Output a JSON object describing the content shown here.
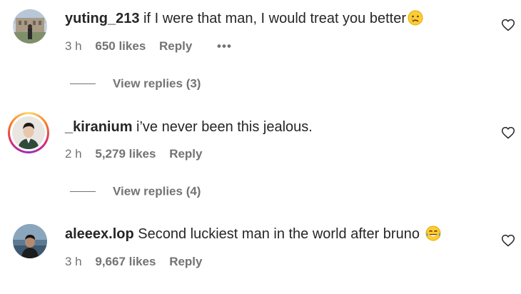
{
  "comments": [
    {
      "username": "yuting_213",
      "text": "if I were that man, I would treat you better",
      "emoji": "sad-face-emoji",
      "time": "3 h",
      "likes": "650 likes",
      "reply": "Reply",
      "more": "•••",
      "view_replies": "View replies (3)",
      "story_ring": false
    },
    {
      "username": "_kiranium",
      "text": "i’ve never been this jealous.",
      "time": "2 h",
      "likes": "5,279 likes",
      "reply": "Reply",
      "view_replies": "View replies (4)",
      "story_ring": true
    },
    {
      "username": "aleeex.lop",
      "text": "Second luckiest man in the world after bruno",
      "emoji": "tears-of-joy-emoji",
      "time": "3 h",
      "likes": "9,667 likes",
      "reply": "Reply",
      "story_ring": false
    }
  ],
  "colors": {
    "text": "#262626",
    "secondary": "#737373",
    "emoji_yellow": "#FFCC33"
  }
}
